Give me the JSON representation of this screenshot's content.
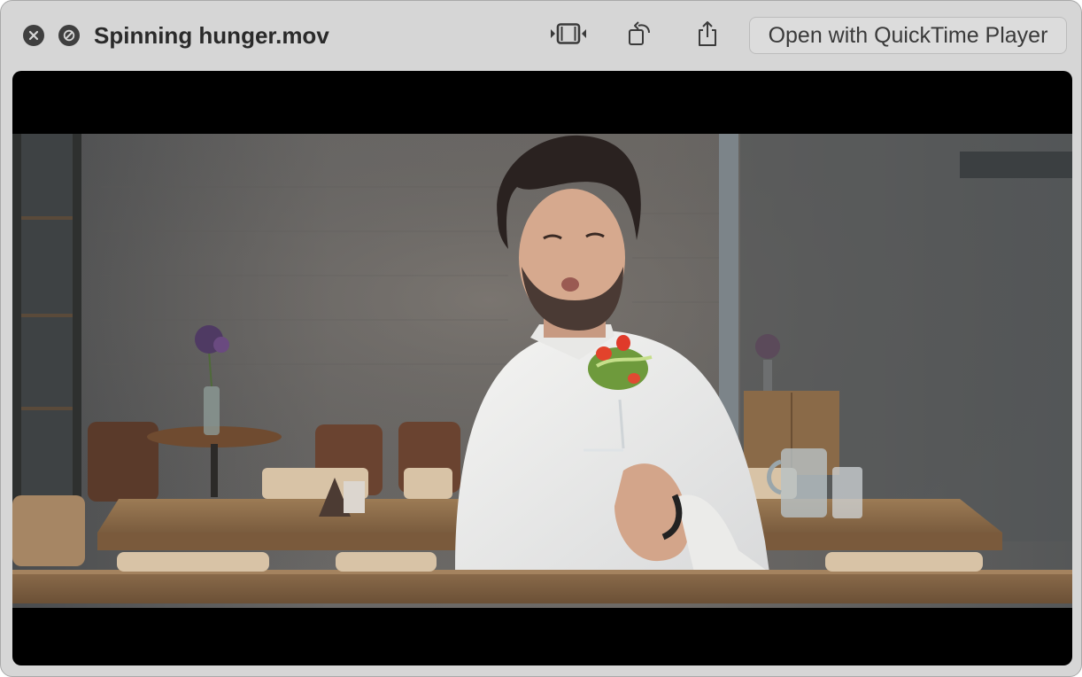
{
  "window": {
    "title": "Spinning hunger.mov"
  },
  "toolbar": {
    "open_with_label": "Open with QuickTime Player",
    "icons": [
      "close-icon",
      "no-entry-icon",
      "trim-icon",
      "rotate-icon",
      "share-icon"
    ]
  },
  "video": {
    "description_icon": "video-frame"
  },
  "colors": {
    "window_bg": "#d6d6d6",
    "button_dark": "#3f3f3f",
    "video_bg": "#000000"
  }
}
